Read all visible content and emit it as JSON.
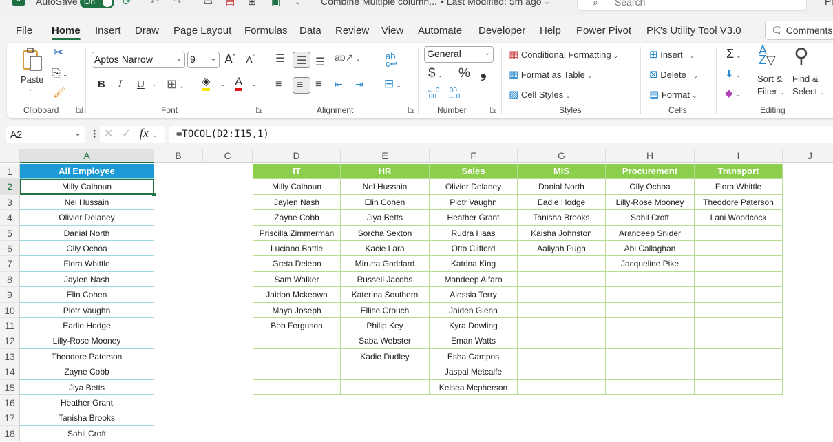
{
  "titlebar": {
    "autosave_label": "AutoSave",
    "autosave_state": "On",
    "doc_title": "Combine Multiple column...",
    "modified": "• Last Modified: 5m ago",
    "search_placeholder": "Search",
    "profile_initials": "Pi"
  },
  "menu": {
    "tabs": [
      "File",
      "Home",
      "Insert",
      "Draw",
      "Page Layout",
      "Formulas",
      "Data",
      "Review",
      "View",
      "Automate",
      "Developer",
      "Help",
      "Power Pivot",
      "PK's Utility Tool V3.0"
    ],
    "active": "Home",
    "comments_label": "Comments"
  },
  "ribbon": {
    "clipboard": {
      "label": "Clipboard",
      "paste": "Paste"
    },
    "font": {
      "label": "Font",
      "font_name": "Aptos Narrow",
      "font_size": "9",
      "bold": "B",
      "italic": "I",
      "underline": "U",
      "grow": "A",
      "shrink": "A",
      "font_color": "A"
    },
    "alignment": {
      "label": "Alignment"
    },
    "number": {
      "label": "Number",
      "format": "General",
      "currency": "$",
      "percent": "%",
      "comma": "❟",
      "inc_decimal": "←.0 .00",
      "dec_decimal": ".00 →.0"
    },
    "styles": {
      "label": "Styles",
      "conditional": "Conditional Formatting",
      "format_table": "Format as Table",
      "cell_styles": "Cell Styles"
    },
    "cells": {
      "label": "Cells",
      "insert": "Insert",
      "delete": "Delete",
      "format": "Format"
    },
    "editing": {
      "label": "Editing",
      "sort_filter_1": "Sort &",
      "sort_filter_2": "Filter",
      "find_select_1": "Find &",
      "find_select_2": "Select"
    }
  },
  "formula_bar": {
    "name_box": "A2",
    "fx": "fx",
    "formula": "=TOCOL(D2:I15,1)"
  },
  "sheet": {
    "columns": [
      "A",
      "B",
      "C",
      "D",
      "E",
      "F",
      "G",
      "H",
      "I",
      "J"
    ],
    "rows": [
      "1",
      "2",
      "3",
      "4",
      "5",
      "6",
      "7",
      "8",
      "9",
      "10",
      "11",
      "12",
      "13",
      "14",
      "15",
      "16",
      "17",
      "18"
    ],
    "all_employee": {
      "header": "All Employee",
      "values": [
        "Milly Calhoun",
        "Nel Hussain",
        "Olivier Delaney",
        "Danial North",
        "Olly Ochoa",
        "Flora Whittle",
        "Jaylen Nash",
        "Elin Cohen",
        "Piotr Vaughn",
        "Eadie Hodge",
        "Lilly-Rose Mooney",
        "Theodore Paterson",
        "Zayne Cobb",
        "Jiya Betts",
        "Heather Grant",
        "Tanisha Brooks",
        "Sahil Croft"
      ]
    },
    "departments": [
      {
        "header": "IT",
        "values": [
          "Milly Calhoun",
          "Jaylen Nash",
          "Zayne Cobb",
          "Priscilla Zimmerman",
          "Luciano Battle",
          "Greta Deleon",
          "Sam Walker",
          "Jaidon Mckeown",
          "Maya Joseph",
          "Bob Ferguson",
          "",
          "",
          "",
          ""
        ]
      },
      {
        "header": "HR",
        "values": [
          "Nel Hussain",
          "Elin Cohen",
          "Jiya Betts",
          "Sorcha Sexton",
          "Kacie Lara",
          "Miruna Goddard",
          "Russell Jacobs",
          "Katerina Southern",
          "Ellise Crouch",
          "Philip Key",
          "Saba Webster",
          "Kadie Dudley",
          "",
          ""
        ]
      },
      {
        "header": "Sales",
        "values": [
          "Olivier Delaney",
          "Piotr Vaughn",
          "Heather Grant",
          "Rudra Haas",
          "Otto Clifford",
          "Katrina King",
          "Mandeep Alfaro",
          "Alessia Terry",
          "Jaiden Glenn",
          "Kyra Dowling",
          "Eman Watts",
          "Esha Campos",
          "Jaspal Metcalfe",
          "Kelsea Mcpherson"
        ]
      },
      {
        "header": "MIS",
        "values": [
          "Danial North",
          "Eadie Hodge",
          "Tanisha Brooks",
          "Kaisha Johnston",
          "Aaliyah Pugh",
          "",
          "",
          "",
          "",
          "",
          "",
          "",
          "",
          ""
        ]
      },
      {
        "header": "Procurement",
        "values": [
          "Olly Ochoa",
          "Lilly-Rose Mooney",
          "Sahil Croft",
          "Arandeep Snider",
          "Abi Callaghan",
          "Jacqueline Pike",
          "",
          "",
          "",
          "",
          "",
          "",
          "",
          ""
        ]
      },
      {
        "header": "Transport",
        "values": [
          "Flora Whittle",
          "Theodore Paterson",
          "Lani Woodcock",
          "",
          "",
          "",
          "",
          "",
          "",
          "",
          "",
          "",
          "",
          ""
        ]
      }
    ]
  },
  "colors": {
    "excel_green": "#217346",
    "all_employee_header": "#1c9ad6",
    "dept_header": "#8ccf4d"
  }
}
